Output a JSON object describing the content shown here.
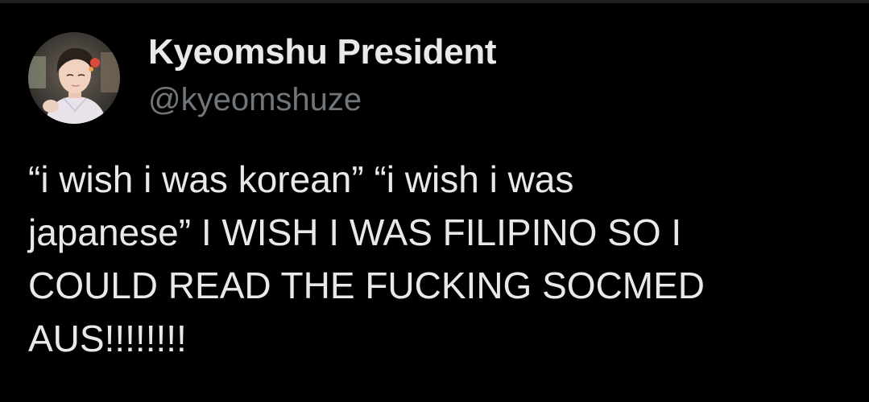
{
  "tweet": {
    "author": {
      "display_name": "Kyeomshu President",
      "handle": "@kyeomshuze",
      "avatar_icon": "profile-photo"
    },
    "text_lines": [
      "“i wish i was korean” “i wish i was",
      "japanese” I WISH I WAS FILIPINO SO I",
      "COULD READ THE FUCKING SOCMED",
      "AUS!!!!!!!!"
    ]
  },
  "colors": {
    "background": "#000000",
    "primary_text": "#e7e9ea",
    "secondary_text": "#71767b"
  }
}
